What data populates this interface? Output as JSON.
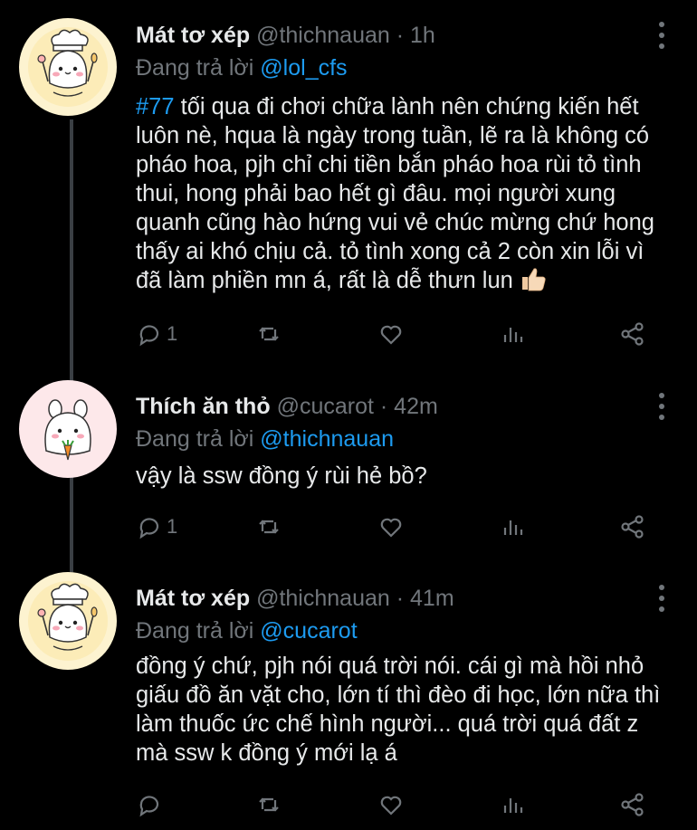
{
  "tweets": [
    {
      "name": "Mát tơ xép",
      "handle": "@thichnauan",
      "dot": "·",
      "time": "1h",
      "reply_prefix": "Đang trả lời",
      "reply_to": "@lol_cfs",
      "hashtag": "#77",
      "text": " tối qua đi chơi chữa lành nên chứng kiến hết luôn nè, hqua là ngày trong tuần, lẽ ra là không có pháo hoa, pjh chỉ chi tiền bắn pháo hoa rùi tỏ tình thui, hong phải bao hết gì đâu. mọi người xung quanh cũng hào hứng vui vẻ chúc mừng chứ hong thấy ai khó chịu cả. tỏ tình xong cả 2 còn xin lỗi vì đã làm phiền mn á, rất là dễ thưn lun ",
      "reply_count": "1"
    },
    {
      "name": "Thích ăn thỏ",
      "handle": "@cucarot",
      "dot": "·",
      "time": "42m",
      "reply_prefix": "Đang trả lời",
      "reply_to": "@thichnauan",
      "text": "vậy là ssw đồng ý rùi hẻ bồ?",
      "reply_count": "1"
    },
    {
      "name": "Mát tơ xép",
      "handle": "@thichnauan",
      "dot": "·",
      "time": "41m",
      "reply_prefix": "Đang trả lời",
      "reply_to": "@cucarot",
      "text": "đồng ý chứ, pjh nói quá trời nói. cái gì mà hồi nhỏ giấu đồ ăn vặt cho, lớn tí thì đèo đi học, lớn nữa thì làm thuốc ức chế hình người... quá trời quá đất z mà ssw k đồng ý mới lạ á",
      "reply_count": ""
    }
  ],
  "colors": {
    "background": "#000000",
    "text": "#e7e9ea",
    "muted": "#71767b",
    "accent": "#1d9bf0",
    "thread_line": "#3a3f44"
  },
  "icons": [
    "reply-icon",
    "retweet-icon",
    "like-icon",
    "views-icon",
    "share-icon",
    "more-icon",
    "thumbs-up-emoji"
  ]
}
